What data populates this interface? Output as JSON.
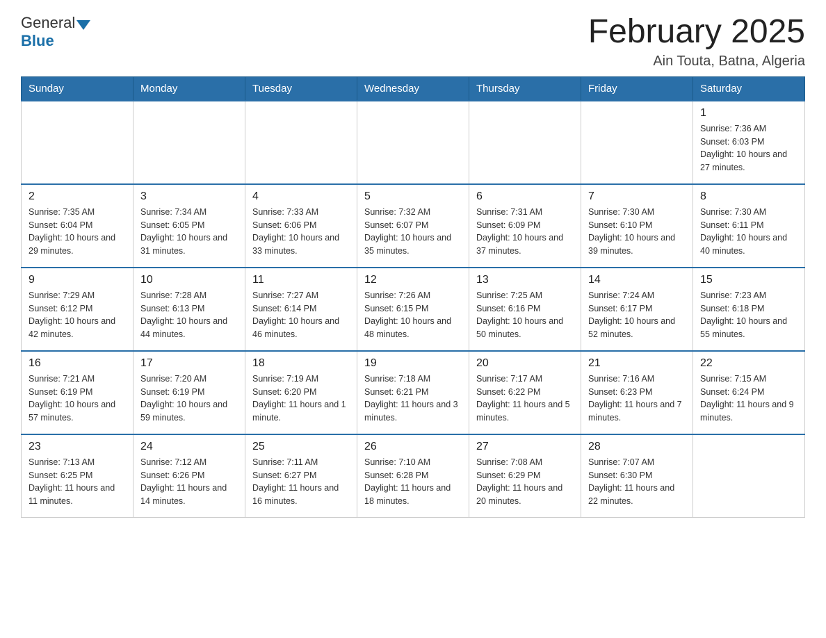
{
  "header": {
    "logo": {
      "part1": "General",
      "part2": "Blue"
    },
    "title": "February 2025",
    "location": "Ain Touta, Batna, Algeria"
  },
  "weekdays": [
    "Sunday",
    "Monday",
    "Tuesday",
    "Wednesday",
    "Thursday",
    "Friday",
    "Saturday"
  ],
  "weeks": [
    [
      {
        "day": "",
        "info": ""
      },
      {
        "day": "",
        "info": ""
      },
      {
        "day": "",
        "info": ""
      },
      {
        "day": "",
        "info": ""
      },
      {
        "day": "",
        "info": ""
      },
      {
        "day": "",
        "info": ""
      },
      {
        "day": "1",
        "info": "Sunrise: 7:36 AM\nSunset: 6:03 PM\nDaylight: 10 hours and 27 minutes."
      }
    ],
    [
      {
        "day": "2",
        "info": "Sunrise: 7:35 AM\nSunset: 6:04 PM\nDaylight: 10 hours and 29 minutes."
      },
      {
        "day": "3",
        "info": "Sunrise: 7:34 AM\nSunset: 6:05 PM\nDaylight: 10 hours and 31 minutes."
      },
      {
        "day": "4",
        "info": "Sunrise: 7:33 AM\nSunset: 6:06 PM\nDaylight: 10 hours and 33 minutes."
      },
      {
        "day": "5",
        "info": "Sunrise: 7:32 AM\nSunset: 6:07 PM\nDaylight: 10 hours and 35 minutes."
      },
      {
        "day": "6",
        "info": "Sunrise: 7:31 AM\nSunset: 6:09 PM\nDaylight: 10 hours and 37 minutes."
      },
      {
        "day": "7",
        "info": "Sunrise: 7:30 AM\nSunset: 6:10 PM\nDaylight: 10 hours and 39 minutes."
      },
      {
        "day": "8",
        "info": "Sunrise: 7:30 AM\nSunset: 6:11 PM\nDaylight: 10 hours and 40 minutes."
      }
    ],
    [
      {
        "day": "9",
        "info": "Sunrise: 7:29 AM\nSunset: 6:12 PM\nDaylight: 10 hours and 42 minutes."
      },
      {
        "day": "10",
        "info": "Sunrise: 7:28 AM\nSunset: 6:13 PM\nDaylight: 10 hours and 44 minutes."
      },
      {
        "day": "11",
        "info": "Sunrise: 7:27 AM\nSunset: 6:14 PM\nDaylight: 10 hours and 46 minutes."
      },
      {
        "day": "12",
        "info": "Sunrise: 7:26 AM\nSunset: 6:15 PM\nDaylight: 10 hours and 48 minutes."
      },
      {
        "day": "13",
        "info": "Sunrise: 7:25 AM\nSunset: 6:16 PM\nDaylight: 10 hours and 50 minutes."
      },
      {
        "day": "14",
        "info": "Sunrise: 7:24 AM\nSunset: 6:17 PM\nDaylight: 10 hours and 52 minutes."
      },
      {
        "day": "15",
        "info": "Sunrise: 7:23 AM\nSunset: 6:18 PM\nDaylight: 10 hours and 55 minutes."
      }
    ],
    [
      {
        "day": "16",
        "info": "Sunrise: 7:21 AM\nSunset: 6:19 PM\nDaylight: 10 hours and 57 minutes."
      },
      {
        "day": "17",
        "info": "Sunrise: 7:20 AM\nSunset: 6:19 PM\nDaylight: 10 hours and 59 minutes."
      },
      {
        "day": "18",
        "info": "Sunrise: 7:19 AM\nSunset: 6:20 PM\nDaylight: 11 hours and 1 minute."
      },
      {
        "day": "19",
        "info": "Sunrise: 7:18 AM\nSunset: 6:21 PM\nDaylight: 11 hours and 3 minutes."
      },
      {
        "day": "20",
        "info": "Sunrise: 7:17 AM\nSunset: 6:22 PM\nDaylight: 11 hours and 5 minutes."
      },
      {
        "day": "21",
        "info": "Sunrise: 7:16 AM\nSunset: 6:23 PM\nDaylight: 11 hours and 7 minutes."
      },
      {
        "day": "22",
        "info": "Sunrise: 7:15 AM\nSunset: 6:24 PM\nDaylight: 11 hours and 9 minutes."
      }
    ],
    [
      {
        "day": "23",
        "info": "Sunrise: 7:13 AM\nSunset: 6:25 PM\nDaylight: 11 hours and 11 minutes."
      },
      {
        "day": "24",
        "info": "Sunrise: 7:12 AM\nSunset: 6:26 PM\nDaylight: 11 hours and 14 minutes."
      },
      {
        "day": "25",
        "info": "Sunrise: 7:11 AM\nSunset: 6:27 PM\nDaylight: 11 hours and 16 minutes."
      },
      {
        "day": "26",
        "info": "Sunrise: 7:10 AM\nSunset: 6:28 PM\nDaylight: 11 hours and 18 minutes."
      },
      {
        "day": "27",
        "info": "Sunrise: 7:08 AM\nSunset: 6:29 PM\nDaylight: 11 hours and 20 minutes."
      },
      {
        "day": "28",
        "info": "Sunrise: 7:07 AM\nSunset: 6:30 PM\nDaylight: 11 hours and 22 minutes."
      },
      {
        "day": "",
        "info": ""
      }
    ]
  ]
}
